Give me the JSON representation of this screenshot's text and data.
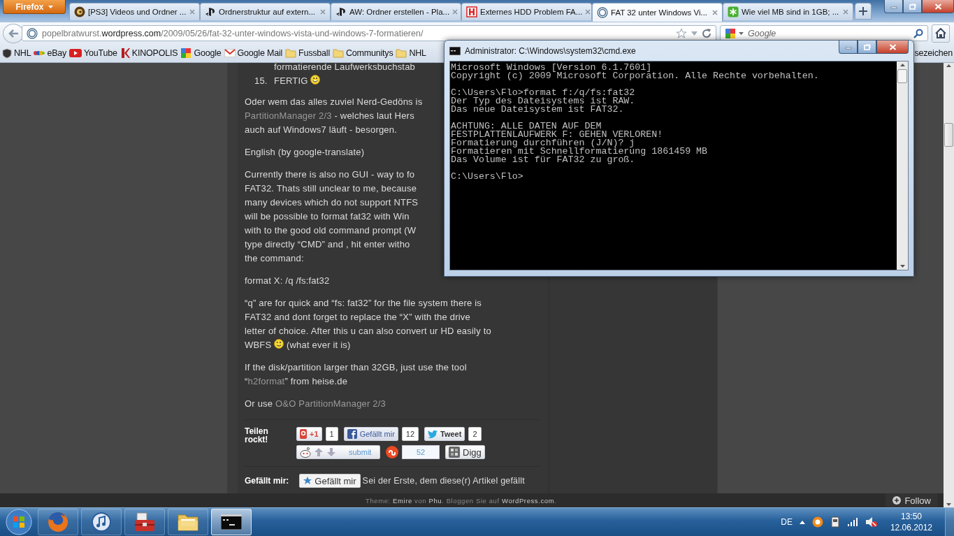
{
  "browser": {
    "menu_button": "Firefox",
    "tabs": [
      {
        "kind": "round",
        "title": "[PS3] Videos und Ordner ...",
        "selected": false
      },
      {
        "kind": "ps",
        "title": "Ordnerstruktur auf extern...",
        "selected": false
      },
      {
        "kind": "ps",
        "title": "AW: Ordner erstellen - Pla...",
        "selected": false
      },
      {
        "kind": "square",
        "title": "Externes HDD Problem FA...",
        "selected": false
      },
      {
        "kind": "circle",
        "title": "FAT 32 unter Windows Vi...",
        "selected": true
      },
      {
        "kind": "star",
        "title": "Wie viel MB sind in 1GB; ...",
        "selected": false
      }
    ],
    "address": [
      {
        "kind": "dim",
        "text": "popelbratwurst."
      },
      {
        "kind": "strong",
        "text": "wordpress.com"
      },
      {
        "kind": "dim",
        "text": "/2009/05/26/fat-32-unter-windows-vista-und-windows-7-formatieren/"
      }
    ],
    "search": {
      "placeholder": "Google"
    },
    "bookmarks": [
      {
        "kind": "shield",
        "label": "NHL"
      },
      {
        "kind": "ebay",
        "label": "eBay"
      },
      {
        "kind": "play",
        "label": "YouTube"
      },
      {
        "kind": "k",
        "label": "KINOPOLIS"
      },
      {
        "kind": "google",
        "label": "Google"
      },
      {
        "kind": "mail",
        "label": "Google Mail"
      },
      {
        "kind": "folder",
        "label": "Fussball"
      },
      {
        "kind": "folder",
        "label": "Communitys"
      },
      {
        "kind": "folder",
        "label": "NHL"
      }
    ],
    "bookmarks_menu": "sezeichen"
  },
  "article": {
    "list": [
      {
        "lines": [
          [
            {
              "kind": "text",
              "text": "formatierende Laufwerksbuchstab"
            }
          ]
        ]
      },
      {
        "number": "15.",
        "lines": [
          [
            {
              "kind": "text",
              "text": "FERTIG "
            },
            {
              "kind": "smiley"
            }
          ]
        ]
      }
    ],
    "paragraphs": [
      {
        "lines": [
          [
            {
              "kind": "text",
              "text": "Oder wem das alles zuviel Nerd-Gedöns is"
            }
          ],
          [
            {
              "kind": "link",
              "text": "PartitionManager 2/3"
            },
            {
              "kind": "text",
              "text": " - welches laut Hers"
            }
          ],
          [
            {
              "kind": "text",
              "text": "auch auf Windows7 läuft - besorgen."
            }
          ]
        ]
      },
      {
        "lines": [
          [
            {
              "kind": "text",
              "text": "English (by google-translate)"
            }
          ]
        ]
      },
      {
        "lines": [
          [
            {
              "kind": "text",
              "text": "Currently there is also no GUI - way to fo"
            }
          ],
          [
            {
              "kind": "text",
              "text": "FAT32. Thats still unclear to me, because"
            }
          ],
          [
            {
              "kind": "text",
              "text": "many devices which do not support NTFS"
            }
          ],
          [
            {
              "kind": "text",
              "text": "will be possible to format fat32 with Win"
            }
          ],
          [
            {
              "kind": "text",
              "text": "with to the good old command prompt (W"
            }
          ],
          [
            {
              "kind": "text",
              "text": "type directly “CMD” and , hit enter witho"
            }
          ],
          [
            {
              "kind": "text",
              "text": "the command:"
            }
          ]
        ]
      },
      {
        "lines": [
          [
            {
              "kind": "text",
              "text": "format X: /q /fs:fat32"
            }
          ]
        ]
      },
      {
        "lines": [
          [
            {
              "kind": "text",
              "text": "“q” are for quick and “fs: fat32” for the file system there is"
            }
          ],
          [
            {
              "kind": "text",
              "text": "FAT32 and dont forget to replace the “X” with the drive"
            }
          ],
          [
            {
              "kind": "text",
              "text": "letter of choice. After this u can also convert ur HD easily to"
            }
          ],
          [
            {
              "kind": "text",
              "text": "WBFS "
            },
            {
              "kind": "wink"
            },
            {
              "kind": "text",
              "text": " (what ever it is)"
            }
          ]
        ]
      },
      {
        "lines": [
          [
            {
              "kind": "text",
              "text": "If the disk/partition larger than 32GB, just use the tool"
            }
          ],
          [
            {
              "kind": "text",
              "text": "“"
            },
            {
              "kind": "link",
              "text": "h2format"
            },
            {
              "kind": "text",
              "text": "” from heise.de"
            }
          ]
        ]
      },
      {
        "lines": [
          [
            {
              "kind": "text",
              "text": "Or use "
            },
            {
              "kind": "link",
              "text": "O&O PartitionManager 2/3"
            }
          ]
        ]
      }
    ],
    "share": {
      "label": "Teilen rockt!",
      "rows": [
        [
          {
            "kind": "gplus",
            "label": "+1",
            "count": "1"
          },
          {
            "kind": "facebook",
            "label": "Gefällt mir",
            "count": "12"
          },
          {
            "kind": "twitter",
            "label": "Tweet",
            "count": "2"
          }
        ],
        [
          {
            "kind": "reddit",
            "label": "submit"
          },
          {
            "kind": "stumble",
            "count": "52"
          },
          {
            "kind": "digg",
            "label": "Digg"
          }
        ]
      ]
    },
    "like": {
      "label": "Gefällt mir:",
      "button": "Gefällt mir",
      "text": "Sei der Erste, dem diese(r) Artikel gefällt"
    }
  },
  "footer": [
    {
      "kind": "text",
      "text": "Theme: "
    },
    {
      "kind": "link",
      "text": "Emire"
    },
    {
      "kind": "text",
      "text": " von "
    },
    {
      "kind": "link",
      "text": "Phu"
    },
    {
      "kind": "text",
      "text": ". Bloggen Sie auf "
    },
    {
      "kind": "link",
      "text": "WordPress.com"
    },
    {
      "kind": "text",
      "text": "."
    }
  ],
  "follow_button": "Follow",
  "console": {
    "title": "Administrator: C:\\Windows\\system32\\cmd.exe",
    "blocks": [
      [
        "Microsoft Windows [Version 6.1.7601]",
        "Copyright (c) 2009 Microsoft Corporation. Alle Rechte vorbehalten."
      ],
      [
        "C:\\Users\\Flo>format f:/q/fs:fat32",
        "Der Typ des Dateisystems ist RAW.",
        "Das neue Dateisystem ist FAT32."
      ],
      [
        "ACHTUNG: ALLE DATEN AUF DEM",
        "FESTPLATTENLAUFWERK F: GEHEN VERLOREN!",
        "Formatierung durchführen (J/N)? j",
        "Formatieren mit Schnellformatierung 1861459 MB",
        "Das Volume ist für FAT32 zu groß."
      ],
      [
        "C:\\Users\\Flo>"
      ]
    ]
  },
  "taskbar": {
    "items": [
      {
        "kind": "firefox",
        "selected": false
      },
      {
        "kind": "itunes",
        "selected": false
      },
      {
        "kind": "toolbox",
        "selected": false
      },
      {
        "kind": "explorer",
        "selected": false
      },
      {
        "kind": "cmd",
        "selected": true
      }
    ],
    "language": "DE",
    "time": "13:50",
    "date": "12.06.2012"
  }
}
